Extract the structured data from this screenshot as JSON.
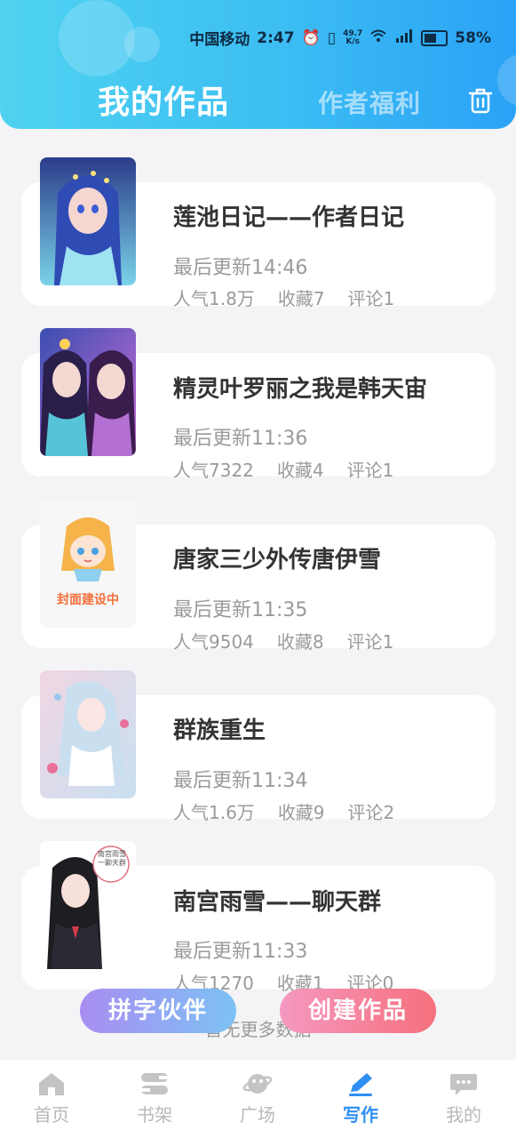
{
  "status_bar": {
    "carrier": "中国移动",
    "time": "2:47",
    "net_speed_value": "49.7",
    "net_speed_unit": "K/s",
    "battery": "58%",
    "icons": [
      "alarm-icon",
      "vibrate-icon",
      "wifi-icon",
      "signal-5g-icon",
      "battery-icon"
    ]
  },
  "header": {
    "title": "我的作品",
    "welfare_tab": "作者福利",
    "trash_icon": "trash-icon"
  },
  "works": [
    {
      "title": "莲池日记——作者日记",
      "updated": "最后更新14:46",
      "popularity": "人气1.8万",
      "favorites": "收藏7",
      "comments": "评论1",
      "cover": "anime-girl-blue-hair"
    },
    {
      "title": "精灵叶罗丽之我是韩天宙",
      "updated": "最后更新11:36",
      "popularity": "人气7322",
      "favorites": "收藏4",
      "comments": "评论1",
      "cover": "anime-two-girls"
    },
    {
      "title": "唐家三少外传唐伊雪",
      "updated": "最后更新11:35",
      "popularity": "人气9504",
      "favorites": "收藏8",
      "comments": "评论1",
      "cover": "placeholder-mascot",
      "cover_text": "封面建设中"
    },
    {
      "title": "群族重生",
      "updated": "最后更新11:34",
      "popularity": "人气1.6万",
      "favorites": "收藏9",
      "comments": "评论2",
      "cover": "anime-girl-white-hair"
    },
    {
      "title": "南宫雨雪——聊天群",
      "updated": "最后更新11:33",
      "popularity": "人气1270",
      "favorites": "收藏1",
      "comments": "评论0",
      "cover": "anime-girl-black-hair",
      "cover_text": "南宫雨雪一聊天群"
    }
  ],
  "loading_text": "暂无更多数据",
  "fab": {
    "partner": "拼字伙伴",
    "create": "创建作品"
  },
  "bottom_nav": [
    {
      "label": "首页",
      "icon": "home-icon"
    },
    {
      "label": "书架",
      "icon": "bookshelf-icon"
    },
    {
      "label": "广场",
      "icon": "planet-icon"
    },
    {
      "label": "写作",
      "icon": "pen-icon",
      "active": true
    },
    {
      "label": "我的",
      "icon": "chat-bubble-icon"
    }
  ],
  "colors": {
    "header_start": "#4fd3f0",
    "header_end": "#2aa2f6",
    "nav_active": "#2f8ff2",
    "fab_partner": "#a98df2",
    "fab_create": "#f5707c"
  }
}
